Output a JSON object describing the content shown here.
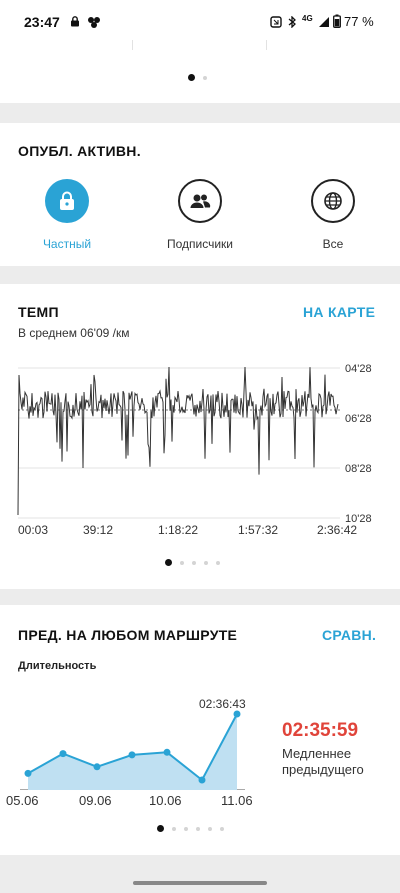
{
  "status_bar": {
    "time": "23:47",
    "battery": "77 %",
    "network": "4G"
  },
  "privacy": {
    "title": "ОПУБЛ. АКТИВН.",
    "options": [
      {
        "label": "Частный",
        "icon": "lock-icon",
        "selected": true
      },
      {
        "label": "Подписчики",
        "icon": "followers-icon",
        "selected": false
      },
      {
        "label": "Все",
        "icon": "globe-icon",
        "selected": false
      }
    ]
  },
  "pace": {
    "title": "ТЕМП",
    "link": "НА КАРТЕ",
    "average": "В среднем 06'09 /км",
    "page_dots": 5,
    "active_dot": 0
  },
  "compare": {
    "title": "ПРЕД. НА ЛЮБОМ МАРШРУТЕ",
    "link": "СРАВН.",
    "metric": "Длительность",
    "peak_label": "02:36:43",
    "result_time": "02:35:59",
    "result_text_1": "Медленнее",
    "result_text_2": "предыдущего",
    "page_dots": 6,
    "active_dot": 0
  },
  "colors": {
    "accent": "#2aa3d5",
    "danger": "#e0443a",
    "line": "#333333"
  },
  "chart_data": [
    {
      "type": "line",
      "title": "ТЕМП",
      "x_tick_labels": [
        "00:03",
        "39:12",
        "1:18:22",
        "1:57:32",
        "2:36:42"
      ],
      "y_tick_labels": [
        "04'28",
        "06'28",
        "08'28",
        "10'28"
      ],
      "y_axis_inverted": true,
      "average_line": "06'09",
      "grid": true
    },
    {
      "type": "area",
      "title": "Длительность",
      "x_tick_labels": [
        "05.06",
        "09.06",
        "10.06",
        "11.06"
      ],
      "values": [
        0.1,
        0.4,
        0.2,
        0.38,
        0.42,
        0.0,
        1.0
      ],
      "peak_label": "02:36:43"
    }
  ]
}
